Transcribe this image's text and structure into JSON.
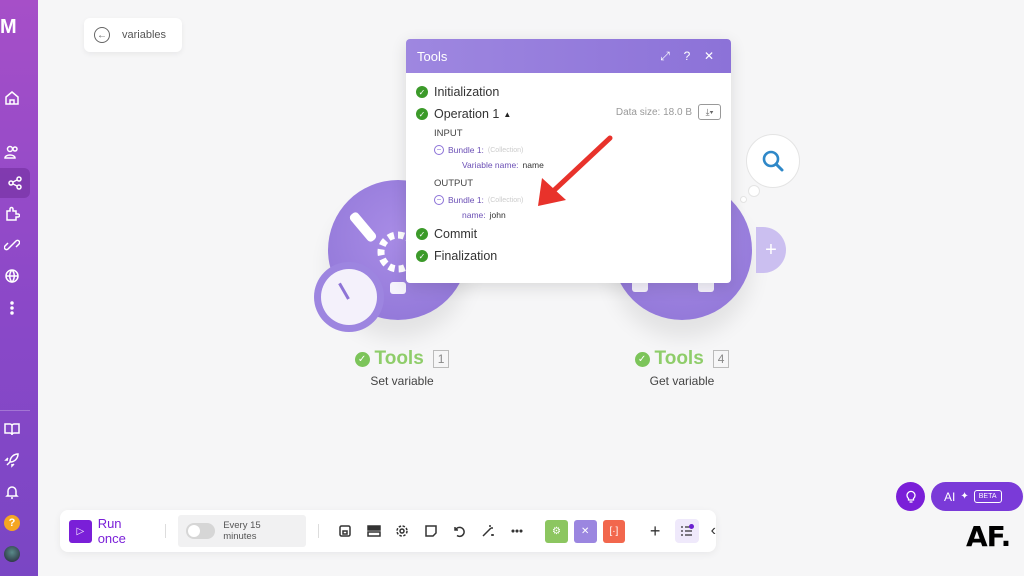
{
  "sidebar": {
    "logo": "M",
    "items": [
      {
        "name": "home",
        "label": "Home"
      },
      {
        "name": "team",
        "label": "Team"
      },
      {
        "name": "scenarios",
        "label": "Scenarios",
        "active": true
      },
      {
        "name": "templates",
        "label": "Templates"
      },
      {
        "name": "connections",
        "label": "Connections"
      },
      {
        "name": "webhooks",
        "label": "Webhooks"
      },
      {
        "name": "more",
        "label": "More"
      }
    ],
    "bottom_items": [
      {
        "name": "docs",
        "label": "Docs"
      },
      {
        "name": "whats-new",
        "label": "What's new"
      },
      {
        "name": "notifications",
        "label": "Notifications"
      },
      {
        "name": "help",
        "label": "?"
      },
      {
        "name": "profile",
        "label": "Profile"
      }
    ]
  },
  "back": {
    "label": "variables"
  },
  "modules": [
    {
      "app": "Tools",
      "number": "1",
      "action": "Set variable"
    },
    {
      "app": "Tools",
      "number": "4",
      "action": "Get variable"
    }
  ],
  "panel": {
    "title": "Tools",
    "header_buttons": [
      "expand",
      "help",
      "close"
    ],
    "header_glyphs": {
      "expand": "⤢",
      "help": "?",
      "close": "✕"
    },
    "steps": {
      "initialization": "Initialization",
      "operation": "Operation 1",
      "commit": "Commit",
      "finalization": "Finalization"
    },
    "data_size": "Data size: 18.0 B",
    "input": {
      "heading": "INPUT",
      "bundle": "Bundle 1:",
      "bundle_type": "(Collection)",
      "key": "Variable name:",
      "value": "name"
    },
    "output": {
      "heading": "OUTPUT",
      "bundle": "Bundle 1:",
      "bundle_type": "(Collection)",
      "key": "name:",
      "value": "john"
    }
  },
  "toolbar": {
    "run_label": "Run once",
    "schedule_label": "Every 15 minutes",
    "schedule_enabled": false
  },
  "bottom_right": {
    "ai_label": "AI",
    "beta_label": "BETA",
    "watermark": "AF."
  },
  "colors": {
    "brand_purple": "#7a1fd8",
    "module_purple": "#9b86e0",
    "success_green": "#3c9a2a",
    "tools_green": "#8fcd6a",
    "annotation_red": "#e8322b"
  }
}
